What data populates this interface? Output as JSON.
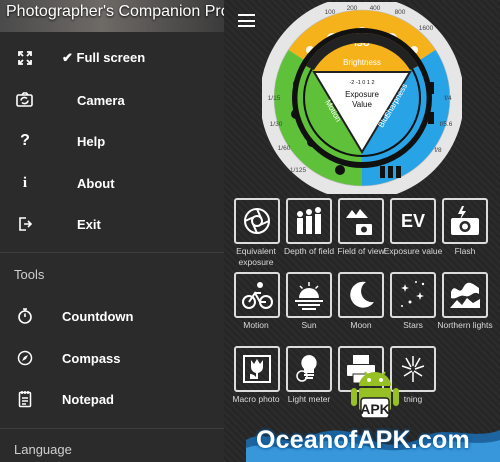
{
  "app": {
    "title": "Photographer's Companion Pro"
  },
  "drawer": {
    "items": [
      {
        "label": "✔ Full screen",
        "icon": "fullscreen-icon"
      },
      {
        "label": "Camera",
        "icon": "camera-switch-icon"
      },
      {
        "label": "Help",
        "icon": "question-icon"
      },
      {
        "label": "About",
        "icon": "info-icon"
      },
      {
        "label": "Exit",
        "icon": "exit-icon"
      }
    ],
    "tools_title": "Tools",
    "tools": [
      {
        "label": "Countdown",
        "icon": "stopwatch-icon"
      },
      {
        "label": "Compass",
        "icon": "compass-icon"
      },
      {
        "label": "Notepad",
        "icon": "notepad-icon"
      }
    ],
    "language_title": "Language"
  },
  "dial": {
    "iso_label": "ISO",
    "brightness_label": "Brightness",
    "center_label_1": "Exposure",
    "center_label_2": "Value",
    "motion_label": "Motion",
    "sharpness_label": "Sharpness",
    "blur_label": "Blur",
    "ev_scale": "-2 -1 0 1 2",
    "ring_numbers": [
      "100",
      "200",
      "400",
      "800",
      "1600",
      "1/15",
      "1/30",
      "1/60",
      "1/125",
      "f/4",
      "f/5.6",
      "f/8"
    ],
    "colors": {
      "yellow": "#f5b21a",
      "green": "#5fc13a",
      "blue": "#27a3e6"
    }
  },
  "tiles": [
    {
      "label": "Equivalent exposure",
      "icon": "aperture-icon"
    },
    {
      "label": "Depth of field",
      "icon": "people-icon"
    },
    {
      "label": "Field of view",
      "icon": "mountain-camera-icon"
    },
    {
      "label": "Exposure value",
      "icon": "ev-icon",
      "text": "EV"
    },
    {
      "label": "Flash",
      "icon": "flash-camera-icon"
    },
    {
      "label": "Motion",
      "icon": "cyclist-icon"
    },
    {
      "label": "Sun",
      "icon": "sunset-icon"
    },
    {
      "label": "Moon",
      "icon": "moon-icon"
    },
    {
      "label": "Stars",
      "icon": "stars-icon"
    },
    {
      "label": "Northern lights",
      "icon": "aurora-icon"
    },
    {
      "label": "Macro photo",
      "icon": "tulip-icon"
    },
    {
      "label": "Light meter",
      "icon": "bulb-icon"
    },
    {
      "label": "",
      "icon": "printer-icon"
    },
    {
      "label": "tning",
      "icon": "lightning-icon"
    }
  ],
  "watermark": {
    "text": "OceanofAPK.com",
    "badge": "APK"
  }
}
